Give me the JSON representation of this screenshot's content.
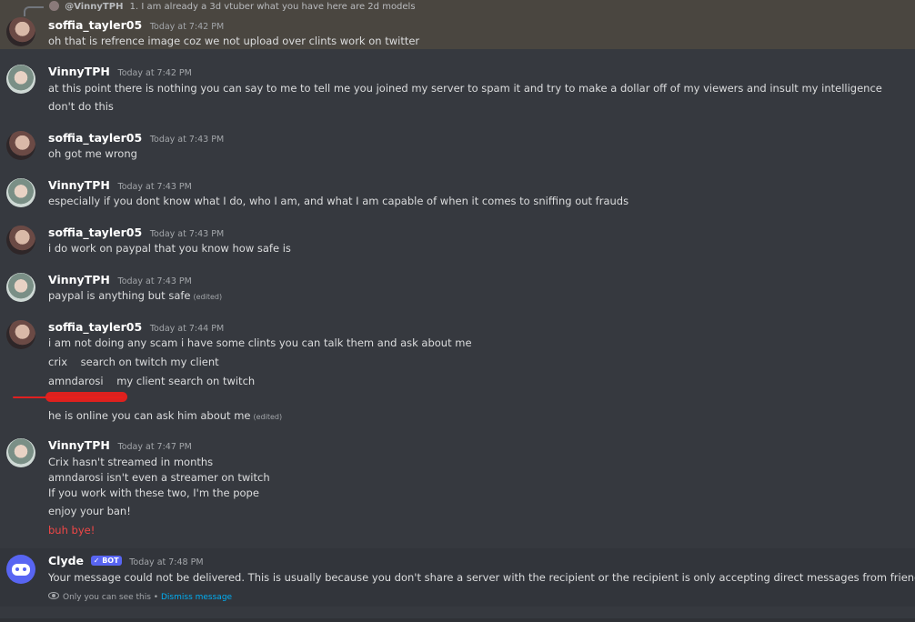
{
  "reply": {
    "author": "@VinnyTPH",
    "text": "1. I am already a 3d vtuber what you have here are 2d models"
  },
  "messages": [
    {
      "author": "soffia_tayler05",
      "time": "Today at 7:42 PM",
      "lines": [
        "oh that is refrence image coz we not upload over clints work on twitter"
      ]
    },
    {
      "author": "VinnyTPH",
      "time": "Today at 7:42 PM",
      "lines": [
        "at this point there is nothing you can say to me to tell me you joined my server to spam it and try to make a dollar off of my viewers and insult my intelligence",
        "don't do this"
      ]
    },
    {
      "author": "soffia_tayler05",
      "time": "Today at 7:43 PM",
      "lines": [
        "oh got me wrong"
      ]
    },
    {
      "author": "VinnyTPH",
      "time": "Today at 7:43 PM",
      "lines": [
        "especially if you dont know what I do, who I am, and what I am capable of when it comes to sniffing out frauds"
      ]
    },
    {
      "author": "soffia_tayler05",
      "time": "Today at 7:43 PM",
      "lines": [
        "i do work on paypal that you know how safe is"
      ]
    },
    {
      "author": "VinnyTPH",
      "time": "Today at 7:43 PM",
      "lines": [
        "paypal is anything but safe"
      ],
      "edited": "(edited)"
    },
    {
      "author": "soffia_tayler05",
      "time": "Today at 7:44 PM",
      "lines": [
        "i am not doing any scam i have some clints you can talk them and ask about me",
        "crix    search on twitch my client",
        "amndarosi    my client search on twitch",
        "he is online you can ask him about me"
      ],
      "edited": "(edited)"
    },
    {
      "author": "VinnyTPH",
      "time": "Today at 7:47 PM",
      "lines": [
        "Crix hasn't streamed in months",
        "amndarosi isn't even a streamer on twitch",
        "If you work with these two, I'm the pope",
        "enjoy your ban!",
        "buh bye!"
      ]
    }
  ],
  "clyde": {
    "author": "Clyde",
    "bot_label": "✓ BOT",
    "time": "Today at 7:48 PM",
    "text": "Your message could not be delivered. This is usually because you don't share a server with the recipient or the recipient is only accepting direct messages from friends. You can see th",
    "ephemeral_note": "Only you can see this •",
    "dismiss": "Dismiss message"
  },
  "colors": {
    "background": "#36393f",
    "highlight": "#4a4640",
    "accent_link": "#00aff4",
    "bot_badge": "#5865f2",
    "red_text": "#f04747"
  }
}
